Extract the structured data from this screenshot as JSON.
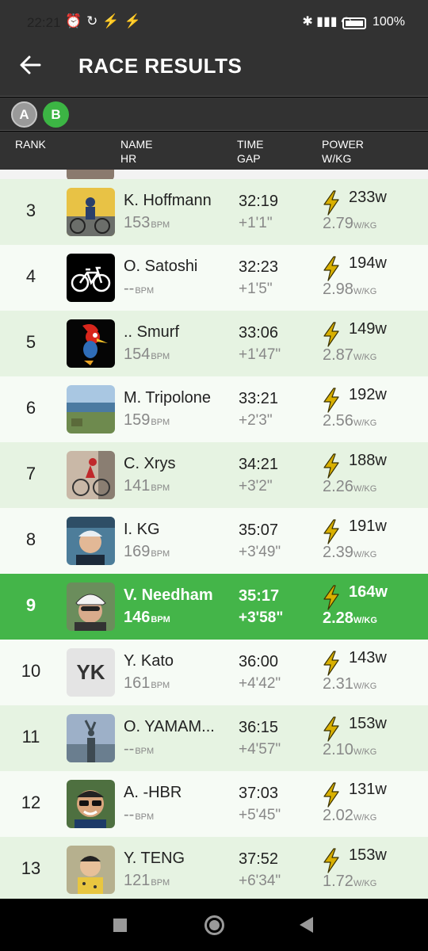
{
  "status": {
    "time": "22:21",
    "battery": "100%"
  },
  "header": {
    "title": "RACE RESULTS"
  },
  "categories": [
    {
      "label": "A",
      "selected": false
    },
    {
      "label": "B",
      "selected": true
    }
  ],
  "columns": {
    "rank": "RANK",
    "name": "NAME",
    "hr": "HR",
    "time": "TIME",
    "gap": "GAP",
    "power": "POWER",
    "wkg": "W/KG"
  },
  "units": {
    "bpm": "BPM",
    "wkg": "W/KG"
  },
  "rows": [
    {
      "rank": "3",
      "name": "K. Hoffmann",
      "hr": "153",
      "time": "32:19",
      "gap": "+1'1\"",
      "watts": "233w",
      "wkg": "2.79",
      "avatar": "cyclists-photo"
    },
    {
      "rank": "4",
      "name": "O. Satoshi",
      "hr": "--",
      "time": "32:23",
      "gap": "+1'5\"",
      "watts": "194w",
      "wkg": "2.98",
      "avatar": "bike-icon"
    },
    {
      "rank": "5",
      "name": ".. Smurf",
      "hr": "154",
      "time": "33:06",
      "gap": "+1'47\"",
      "watts": "149w",
      "wkg": "2.87",
      "avatar": "woodpecker-cartoon"
    },
    {
      "rank": "6",
      "name": "M. Tripolone",
      "hr": "159",
      "time": "33:21",
      "gap": "+2'3\"",
      "watts": "192w",
      "wkg": "2.56",
      "avatar": "coast-photo"
    },
    {
      "rank": "7",
      "name": "C. Xrys",
      "hr": "141",
      "time": "34:21",
      "gap": "+3'2\"",
      "watts": "188w",
      "wkg": "2.26",
      "avatar": "cyclist-photo"
    },
    {
      "rank": "8",
      "name": "I. KG",
      "hr": "169",
      "time": "35:07",
      "gap": "+3'49\"",
      "watts": "191w",
      "wkg": "2.39",
      "avatar": "man-cap-photo"
    },
    {
      "rank": "9",
      "name": "V. Needham",
      "hr": "146",
      "time": "35:17",
      "gap": "+3'58\"",
      "watts": "164w",
      "wkg": "2.28",
      "avatar": "helmet-photo",
      "highlight": true
    },
    {
      "rank": "10",
      "name": "Y. Kato",
      "hr": "161",
      "time": "36:00",
      "gap": "+4'42\"",
      "watts": "143w",
      "wkg": "2.31",
      "avatar": "initials",
      "initials": "YK"
    },
    {
      "rank": "11",
      "name": "O. YAMAM...",
      "hr": "--",
      "time": "36:15",
      "gap": "+4'57\"",
      "watts": "153w",
      "wkg": "2.10",
      "avatar": "statue-photo"
    },
    {
      "rank": "12",
      "name": "A. -HBR",
      "hr": "--",
      "time": "37:03",
      "gap": "+5'45\"",
      "watts": "131w",
      "wkg": "2.02",
      "avatar": "man-glasses-photo"
    },
    {
      "rank": "13",
      "name": "Y. TENG",
      "hr": "121",
      "time": "37:52",
      "gap": "+6'34\"",
      "watts": "153w",
      "wkg": "1.72",
      "avatar": "child-photo"
    }
  ],
  "colors": {
    "accent": "#44b549",
    "row_even": "#e6f3e2",
    "row_odd": "#f6fbf5",
    "bolt": "#d9b000",
    "header_bg": "#323232"
  }
}
